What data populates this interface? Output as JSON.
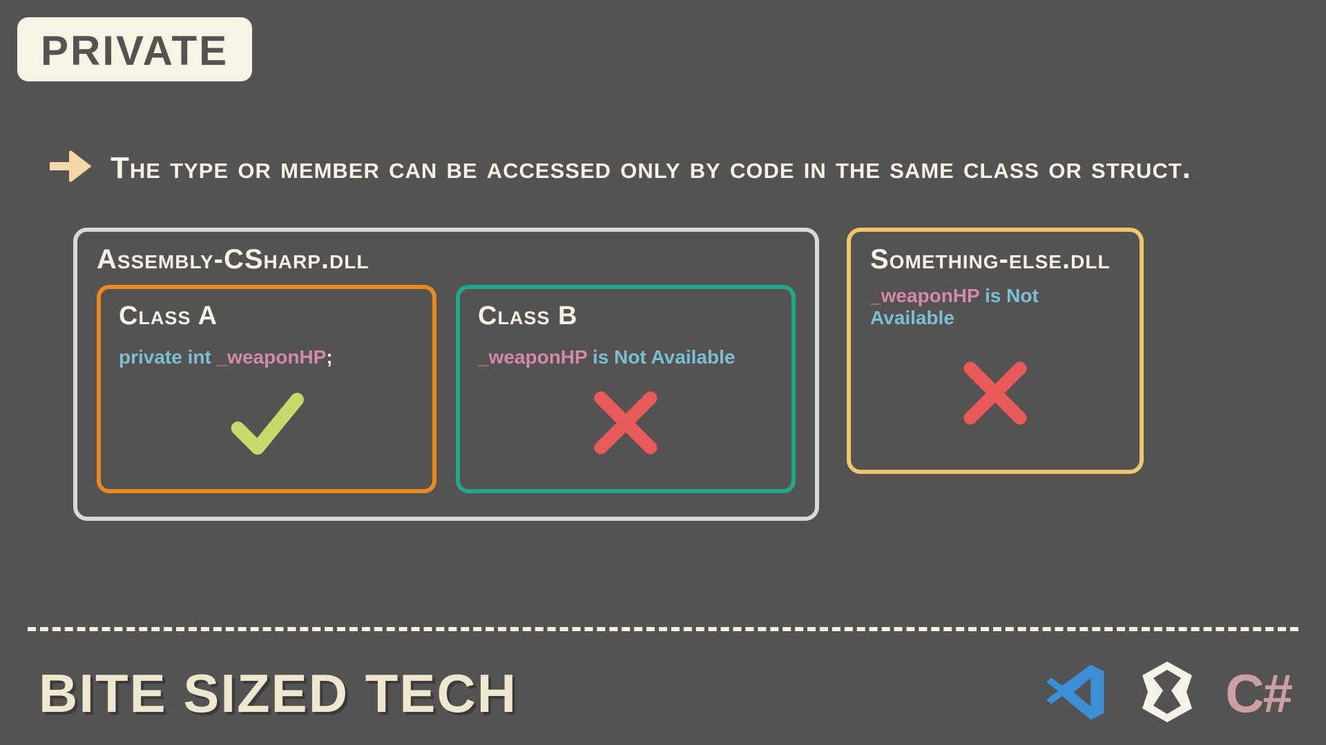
{
  "title_badge": "PRIVATE",
  "description": "The type or member can be accessed only by code in the same class or struct.",
  "assembly_main": {
    "title": "Assembly-CSharp.dll",
    "class_a": {
      "title": "Class A",
      "kw1": "private",
      "kw2": "int",
      "var": "_weaponHP",
      "punct": ";"
    },
    "class_b": {
      "title": "Class B",
      "var": "_weaponHP",
      "msg": " is Not Available"
    }
  },
  "assembly_other": {
    "title": "Something-else.dll",
    "var": "_weaponHP",
    "msg": " is Not Available"
  },
  "brand": "BITE SIZED TECH",
  "csharp_label": "C#",
  "colors": {
    "bg": "#555252",
    "cream": "#f7f3e5",
    "orange": "#e88a1f",
    "teal": "#20a888",
    "yellow": "#f0c66f",
    "checkmark": "#c6d96a",
    "cross": "#e85a5a",
    "vscode": "#3a8fd6",
    "pink": "#caa0a3"
  }
}
